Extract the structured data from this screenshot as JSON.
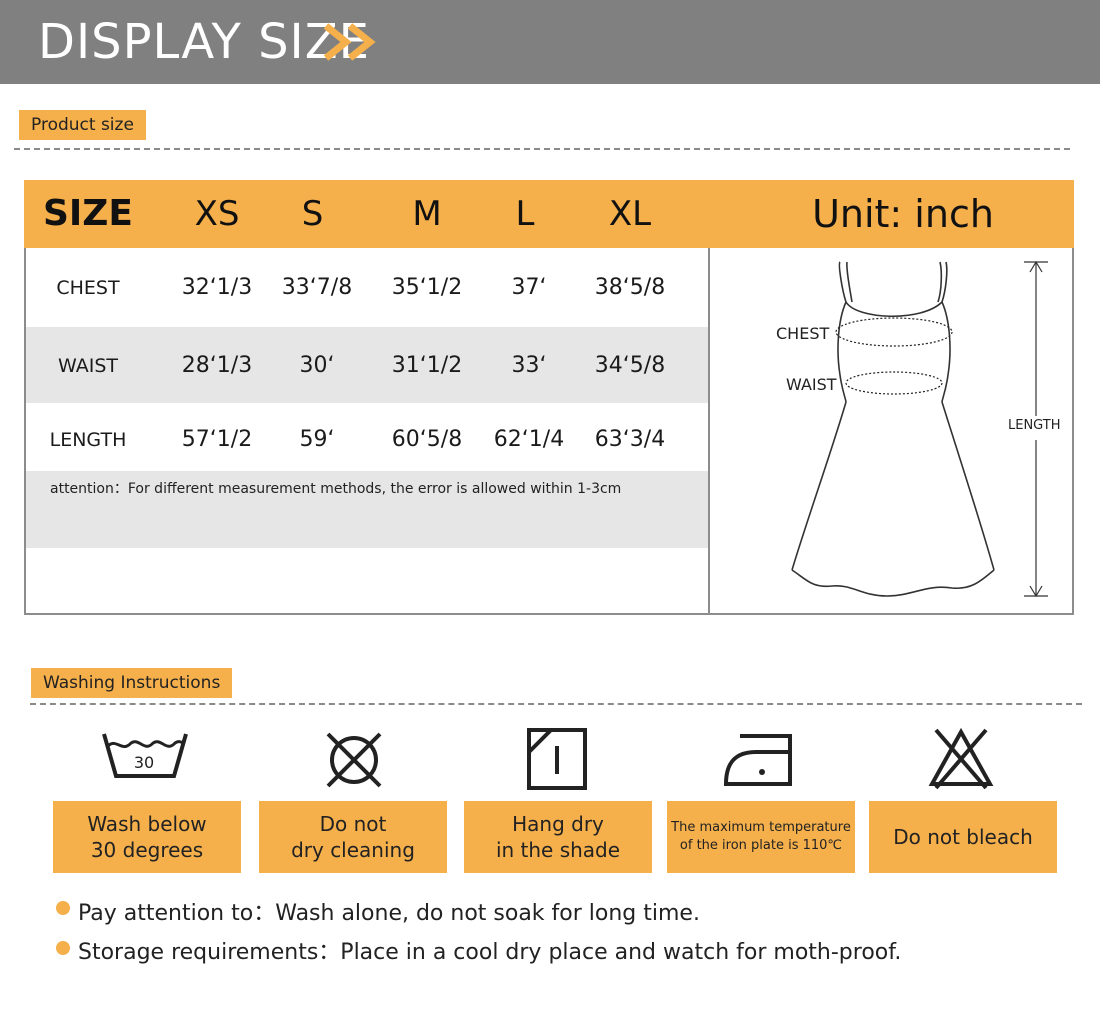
{
  "header": {
    "title": "DISPLAY SIZE"
  },
  "sections": {
    "product_size": "Product size",
    "washing": "Washing Instructions"
  },
  "table": {
    "size_label": "SIZE",
    "sizes": [
      "XS",
      "S",
      "M",
      "L",
      "XL"
    ],
    "unit": "Unit: inch",
    "rows": [
      {
        "label": "CHEST",
        "values": [
          "32‘1/3",
          "33‘7/8",
          "35‘1/2",
          "37‘",
          "38‘5/8"
        ]
      },
      {
        "label": "WAIST",
        "values": [
          "28‘1/3",
          "30‘",
          "31‘1/2",
          "33‘",
          "34‘5/8"
        ]
      },
      {
        "label": "LENGTH",
        "values": [
          "57‘1/2",
          "59‘",
          "60‘5/8",
          "62‘1/4",
          "63‘3/4"
        ]
      }
    ],
    "note": "attention：For different measurement methods, the error is allowed within 1-3cm"
  },
  "diagram": {
    "chest": "CHEST",
    "waist": "WAIST",
    "length": "LENGTH"
  },
  "wash": [
    {
      "icon": "wash-30-icon",
      "badge": "30",
      "line1": "Wash below",
      "line2": "30 degrees"
    },
    {
      "icon": "no-dry-clean-icon",
      "line1": "Do not",
      "line2": "dry cleaning"
    },
    {
      "icon": "hang-dry-shade-icon",
      "line1": "Hang dry",
      "line2": "in the shade"
    },
    {
      "icon": "iron-icon",
      "line1": "The maximum temperature",
      "line2": "of the iron plate is 110℃"
    },
    {
      "icon": "no-bleach-icon",
      "line1": "Do not bleach"
    }
  ],
  "notes": [
    {
      "label": "Pay attention to：",
      "text": "Wash alone, do not soak for long time."
    },
    {
      "label": "Storage requirements：",
      "text": "Place in a cool dry place and watch for moth-proof."
    }
  ],
  "colors": {
    "accent": "#f5b04c",
    "header": "#808080",
    "row_gray": "#e6e6e6"
  }
}
